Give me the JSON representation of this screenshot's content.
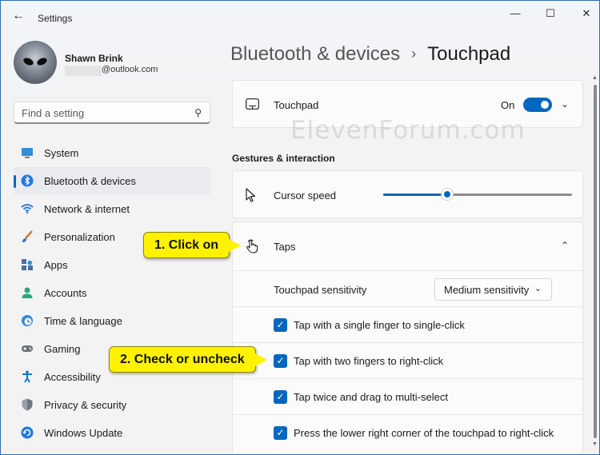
{
  "window": {
    "title": "Settings"
  },
  "user": {
    "name": "Shawn Brink",
    "email": "@outlook.com"
  },
  "search": {
    "placeholder": "Find a setting"
  },
  "sidebar": {
    "items": [
      {
        "label": "System",
        "icon": "monitor-icon",
        "color": "#2f8fd8"
      },
      {
        "label": "Bluetooth & devices",
        "icon": "bluetooth-icon",
        "color": "#1f7ae0"
      },
      {
        "label": "Network & internet",
        "icon": "wifi-icon",
        "color": "#2a7fd0"
      },
      {
        "label": "Personalization",
        "icon": "brush-icon",
        "color": "#d07a2a"
      },
      {
        "label": "Apps",
        "icon": "apps-icon",
        "color": "#4a6ea8"
      },
      {
        "label": "Accounts",
        "icon": "person-icon",
        "color": "#2aa57a"
      },
      {
        "label": "Time & language",
        "icon": "clock-globe-icon",
        "color": "#2d8ad6"
      },
      {
        "label": "Gaming",
        "icon": "gamepad-icon",
        "color": "#6b6f76"
      },
      {
        "label": "Accessibility",
        "icon": "accessibility-icon",
        "color": "#1877d0"
      },
      {
        "label": "Privacy & security",
        "icon": "shield-icon",
        "color": "#707782"
      },
      {
        "label": "Windows Update",
        "icon": "update-icon",
        "color": "#1f7ae0"
      }
    ],
    "active_index": 1
  },
  "breadcrumb": {
    "parent": "Bluetooth & devices",
    "separator": "›",
    "current": "Touchpad"
  },
  "touchpad_card": {
    "label": "Touchpad",
    "state": "On",
    "on": true
  },
  "section": {
    "heading": "Gestures & interaction"
  },
  "cursor_speed": {
    "label": "Cursor speed",
    "value_fraction": 0.34
  },
  "taps": {
    "label": "Taps",
    "sensitivity_label": "Touchpad sensitivity",
    "sensitivity_value": "Medium sensitivity",
    "options": [
      {
        "label": "Tap with a single finger to single-click",
        "checked": true
      },
      {
        "label": "Tap with two fingers to right-click",
        "checked": true
      },
      {
        "label": "Tap twice and drag to multi-select",
        "checked": true
      },
      {
        "label": "Press the lower right corner of the touchpad to right-click",
        "checked": true
      }
    ]
  },
  "annotations": {
    "callout1": "1. Click on",
    "callout2": "2. Check or uncheck"
  },
  "watermark": "ElevenForum.com",
  "colors": {
    "accent": "#0067c0",
    "callout": "#fff200"
  }
}
